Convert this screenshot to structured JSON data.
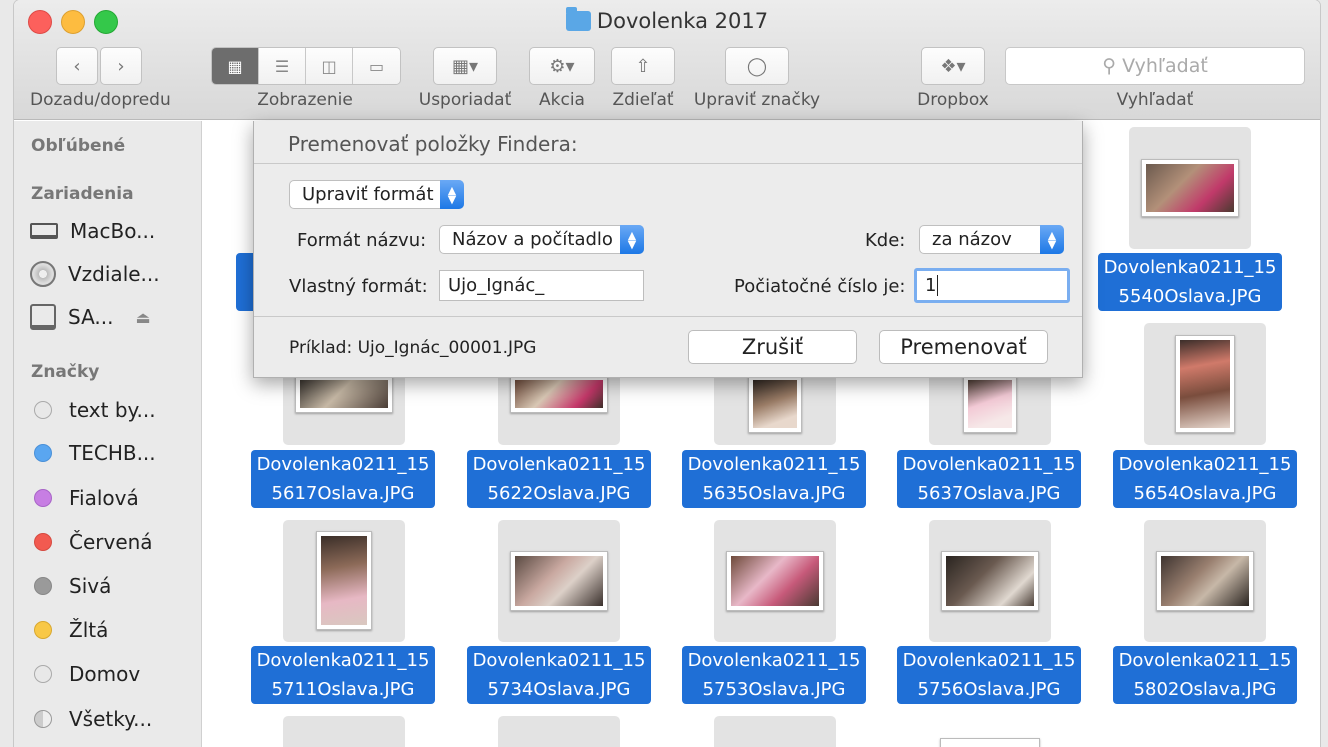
{
  "window": {
    "title": "Dovolenka 2017"
  },
  "toolbar": {
    "back_forward_label": "Dozadu/dopredu",
    "view_label": "Zobrazenie",
    "arrange_label": "Usporiadať",
    "action_label": "Akcia",
    "share_label": "Zdieľať",
    "tags_label": "Upraviť značky",
    "dropbox_label": "Dropbox",
    "search_label": "Vyhľadať",
    "search_placeholder": "Vyhľadať"
  },
  "sidebar": {
    "favorites_header": "Obľúbené",
    "devices_header": "Zariadenia",
    "devices": [
      {
        "label": "MacBo...",
        "icon": "laptop-icon"
      },
      {
        "label": "Vzdiale...",
        "icon": "disc-icon"
      },
      {
        "label": "SA...",
        "icon": "drive-icon"
      }
    ],
    "tags_header": "Značky",
    "tags": [
      {
        "label": "text by...",
        "color": "#e8e8e8"
      },
      {
        "label": "TECHB...",
        "color": "#5aa6f0"
      },
      {
        "label": "Fialová",
        "color": "#c77ee3"
      },
      {
        "label": "Červená",
        "color": "#f25a50"
      },
      {
        "label": "Sivá",
        "color": "#9a9a9a"
      },
      {
        "label": "Žltá",
        "color": "#f8c847"
      },
      {
        "label": "Domov",
        "color": "#e8e8e8"
      },
      {
        "label": "Všetky...",
        "color": "#d8d8d8"
      }
    ]
  },
  "files": [
    {
      "line1": "Dovolenka0211_15",
      "line2": "5540Oslava.JPG"
    },
    {
      "line1": "Dovolenka0211_15",
      "line2": "5617Oslava.JPG"
    },
    {
      "line1": "Dovolenka0211_15",
      "line2": "5622Oslava.JPG"
    },
    {
      "line1": "Dovolenka0211_15",
      "line2": "5635Oslava.JPG"
    },
    {
      "line1": "Dovolenka0211_15",
      "line2": "5637Oslava.JPG"
    },
    {
      "line1": "Dovolenka0211_15",
      "line2": "5654Oslava.JPG"
    },
    {
      "line1": "Dovolenka0211_15",
      "line2": "5711Oslava.JPG"
    },
    {
      "line1": "Dovolenka0211_15",
      "line2": "5734Oslava.JPG"
    },
    {
      "line1": "Dovolenka0211_15",
      "line2": "5753Oslava.JPG"
    },
    {
      "line1": "Dovolenka0211_15",
      "line2": "5756Oslava.JPG"
    },
    {
      "line1": "Dovolenka0211_15",
      "line2": "5802Oslava.JPG"
    }
  ],
  "dialog": {
    "title": "Premenovať položky Findera:",
    "mode": "Upraviť formát",
    "name_format_label": "Formát názvu:",
    "name_format_value": "Názov a počítadlo",
    "where_label": "Kde:",
    "where_value": "za názov",
    "custom_format_label": "Vlastný formát:",
    "custom_format_value": "Ujo_Ignác_",
    "start_number_label": "Počiatočné číslo je:",
    "start_number_value": "1",
    "example": "Príklad: Ujo_Ignác_00001.JPG",
    "cancel": "Zrušiť",
    "rename": "Premenovať"
  }
}
